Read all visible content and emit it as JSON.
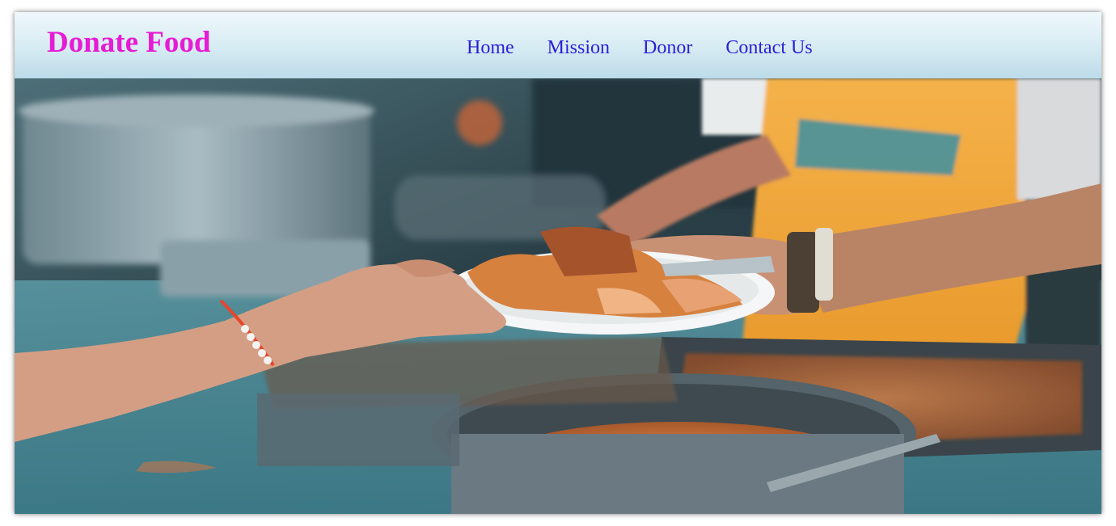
{
  "brand": {
    "title": "Donate Food"
  },
  "nav": {
    "items": [
      {
        "label": "Home"
      },
      {
        "label": "Mission"
      },
      {
        "label": "Donor"
      },
      {
        "label": "Contact Us"
      }
    ]
  },
  "hero": {
    "image_description_icon": "food-serving-photo",
    "colors": {
      "background": "#2f6b78",
      "apron": "#f2a93a",
      "plate": "#f4f6f7",
      "food": "#d77a3a",
      "skin": "#c98f74",
      "metal": "#7d8c94"
    }
  },
  "theme": {
    "brand_color": "#e61cd5",
    "link_color": "#2b1fd6"
  }
}
